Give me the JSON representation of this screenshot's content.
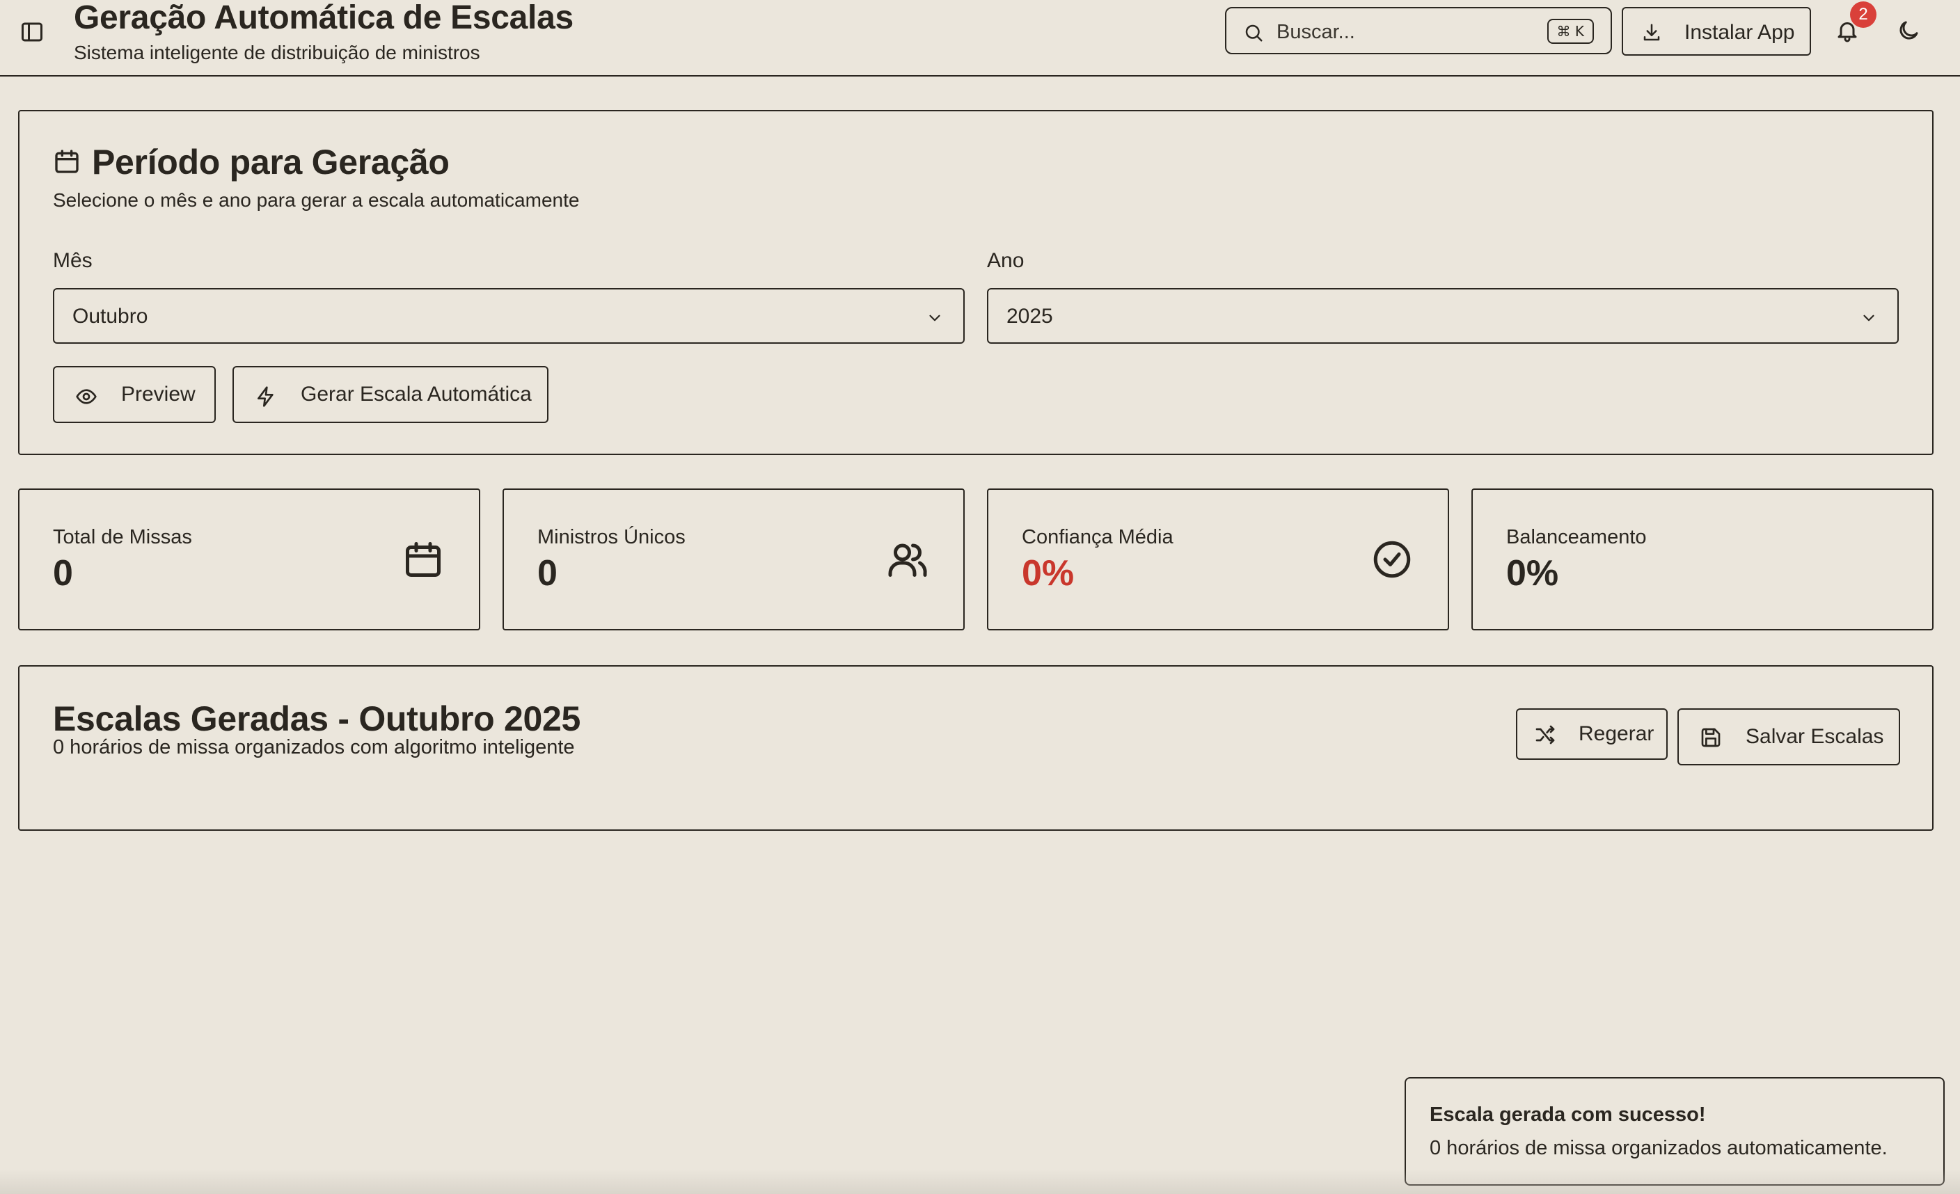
{
  "header": {
    "title": "Geração Automática de Escalas",
    "subtitle": "Sistema inteligente de distribuição de ministros",
    "search_placeholder": "Buscar...",
    "search_shortcut": "⌘ K",
    "install_label": "Instalar App",
    "notification_count": "2",
    "icons": [
      "sidebar-toggle-icon",
      "search-icon",
      "download-icon",
      "bell-icon",
      "moon-icon"
    ]
  },
  "period": {
    "title": "Período para Geração",
    "description": "Selecione o mês e ano para gerar a escala automaticamente",
    "month_label": "Mês",
    "month_value": "Outubro",
    "year_label": "Ano",
    "year_value": "2025",
    "preview_label": "Preview",
    "generate_label": "Gerar Escala Automática"
  },
  "stats": [
    {
      "label": "Total de Missas",
      "value": "0",
      "icon": "calendar-icon"
    },
    {
      "label": "Ministros Únicos",
      "value": "0",
      "icon": "users-icon"
    },
    {
      "label": "Confiança Média",
      "value": "0%",
      "icon": "check-circle-icon",
      "value_color": "#c9372c"
    },
    {
      "label": "Balanceamento",
      "value": "0%"
    }
  ],
  "results": {
    "title": "Escalas Geradas - Outubro 2025",
    "description": "0 horários de missa organizados com algoritmo inteligente",
    "regenerate_label": "Regerar",
    "save_label": "Salvar Escalas"
  },
  "toast": {
    "title": "Escala gerada com sucesso!",
    "description": "0 horários de missa organizados automaticamente."
  },
  "colors": {
    "background": "#ebe6dc",
    "text": "#2a2620",
    "accent_red": "#c9372c",
    "badge": "#d9403a"
  }
}
